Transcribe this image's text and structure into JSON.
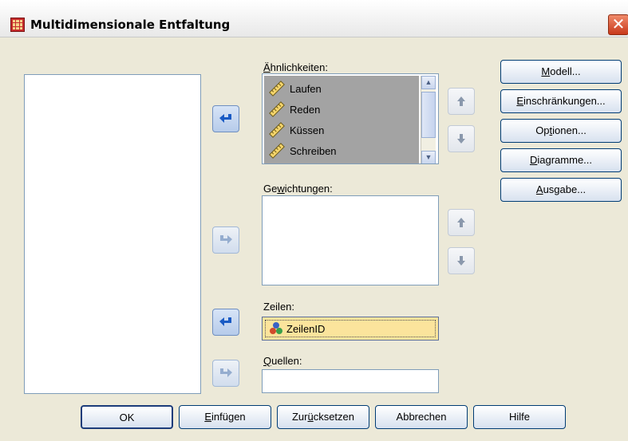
{
  "window": {
    "title": "Multidimensionale Entfaltung",
    "close_glyph": "✕"
  },
  "similarities": {
    "label": "Ähnlichkeiten:",
    "items": [
      {
        "label": "Laufen",
        "icon": "ruler-icon"
      },
      {
        "label": "Reden",
        "icon": "ruler-icon"
      },
      {
        "label": "Küssen",
        "icon": "ruler-icon"
      },
      {
        "label": "Schreiben",
        "icon": "ruler-icon"
      }
    ]
  },
  "weights": {
    "label": "Gewichtungen:"
  },
  "rows": {
    "label": "Zeilen:",
    "value": "ZeilenID",
    "icon": "nominal-variable-icon"
  },
  "sources": {
    "label": "Quellen:",
    "value": ""
  },
  "side_buttons": {
    "model": "Modell...",
    "restrictions": "Einschränkungen...",
    "options": "Optionen...",
    "plots": "Diagramme...",
    "output": "Ausgabe..."
  },
  "bottom_buttons": {
    "ok": "OK",
    "paste": "Einfügen",
    "reset": "Zurücksetzen",
    "cancel": "Abbrechen",
    "help": "Hilfe"
  },
  "colors": {
    "selection": "#a0a0a0",
    "row_field": "#fbe49c",
    "accent": "#1a5bc4"
  }
}
